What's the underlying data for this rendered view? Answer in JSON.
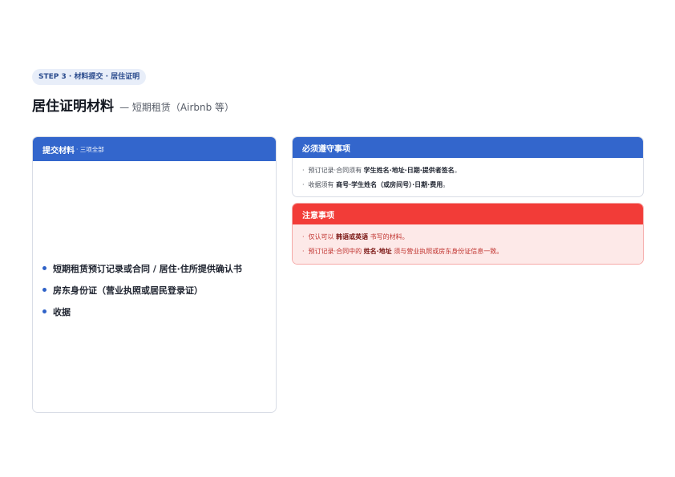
{
  "step_label": "STEP 3 · 材料提交 · 居住证明",
  "title": {
    "main": "居住证明材料",
    "sub": "— 短期租赁（Airbnb 等）"
  },
  "materials_panel": {
    "header": "提交材料",
    "header_sub": "· 三项全部",
    "items": [
      "短期租赁预订记录或合同 / 居住·住所提供确认书",
      "房东身份证（营业执照或居民登录证）",
      "收据"
    ]
  },
  "rules_panel": {
    "header": "必须遵守事项",
    "items": [
      {
        "before": "预订记录·合同须有 ",
        "bold": "学生姓名·地址·日期·提供者签名",
        "after": "。"
      },
      {
        "before": "收据须有 ",
        "bold": "商号·学生姓名（或房间号）·日期·费用",
        "after": "。"
      }
    ]
  },
  "notes_panel": {
    "header": "注意事项",
    "items": [
      {
        "before": "仅认可以 ",
        "bold": "韩语或英语",
        "after": " 书写的材料。"
      },
      {
        "before": "预订记录·合同中的 ",
        "bold": "姓名·地址",
        "after": " 须与营业执照或房东身份证信息一致。"
      }
    ]
  },
  "colors": {
    "blue_header": "#3366cc",
    "red_header": "#f23c38",
    "notes_background": "#fde9e8",
    "step_pill": "#e8eef9"
  }
}
